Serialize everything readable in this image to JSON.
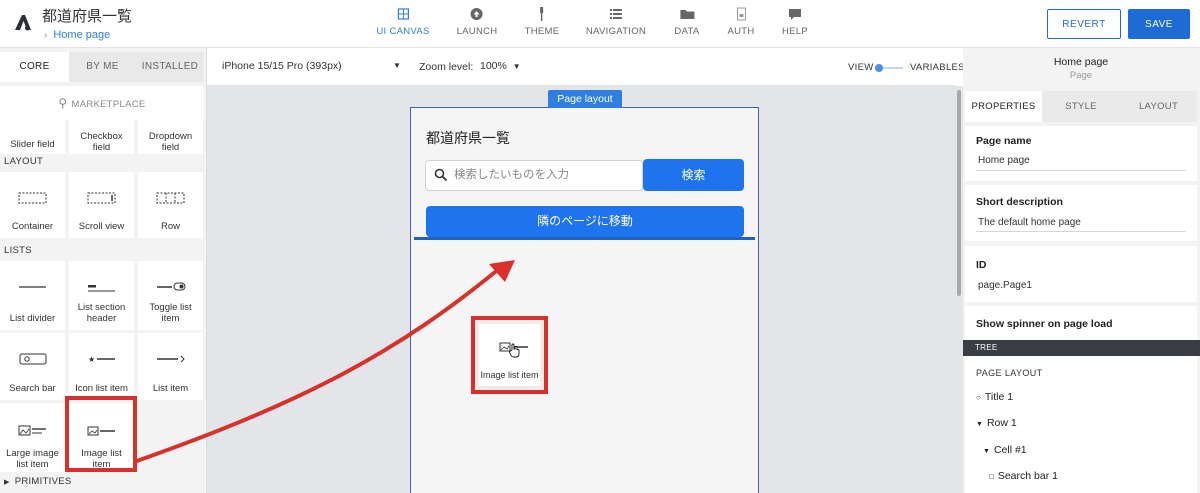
{
  "app": {
    "title": "都道府県一覧",
    "breadcrumb": "Home page"
  },
  "nav": [
    {
      "label": "UI CANVAS",
      "icon": "ui-canvas-icon",
      "active": true
    },
    {
      "label": "LAUNCH",
      "icon": "launch-icon",
      "active": false
    },
    {
      "label": "THEME",
      "icon": "theme-icon",
      "active": false
    },
    {
      "label": "NAVIGATION",
      "icon": "navigation-icon",
      "active": false
    },
    {
      "label": "DATA",
      "icon": "data-icon",
      "active": false
    },
    {
      "label": "AUTH",
      "icon": "auth-icon",
      "active": false
    },
    {
      "label": "HELP",
      "icon": "help-icon",
      "active": false
    }
  ],
  "actions": {
    "revert": "REVERT",
    "save": "SAVE"
  },
  "palette": {
    "tabs": [
      "CORE",
      "BY ME",
      "INSTALLED"
    ],
    "marketplace": "MARKETPLACE",
    "fields": [
      "Slider field",
      "Checkbox field",
      "Dropdown field"
    ],
    "layout_title": "LAYOUT",
    "layout": [
      "Container",
      "Scroll view",
      "Row"
    ],
    "lists_title": "LISTS",
    "lists": [
      "List divider",
      "List section header",
      "Toggle list item",
      "Search bar",
      "Icon list item",
      "List item",
      "Large image list item",
      "Image list item"
    ],
    "primitives_title": "PRIMITIVES"
  },
  "controls": {
    "device": "iPhone 15/15 Pro (393px)",
    "zoom_label": "Zoom level:",
    "zoom_value": "100%",
    "view": "VIEW",
    "variables": "VARIABLES"
  },
  "canvas": {
    "tag": "Page layout",
    "title": "都道府県一覧",
    "search_placeholder": "検索したいものを入力",
    "search_button": "検索",
    "next_button": "隣のページに移動",
    "dragging_item": "Image list item"
  },
  "panel": {
    "header_title": "Home page",
    "header_sub": "Page",
    "tabs": [
      "PROPERTIES",
      "STYLE",
      "LAYOUT"
    ],
    "page_name_label": "Page name",
    "page_name_value": "Home page",
    "short_desc_label": "Short description",
    "short_desc_value": "The default home page",
    "id_label": "ID",
    "id_value": "page.Page1",
    "spinner_label": "Show spinner on page load",
    "tree_title": "TREE",
    "tree_section": "PAGE LAYOUT",
    "tree_nodes": [
      "Title 1",
      "Row 1",
      "Cell #1",
      "Search bar 1"
    ]
  },
  "colors": {
    "accent": "#1f73ee",
    "highlight": "#d8312b",
    "tree_bar": "#3a3d44"
  }
}
